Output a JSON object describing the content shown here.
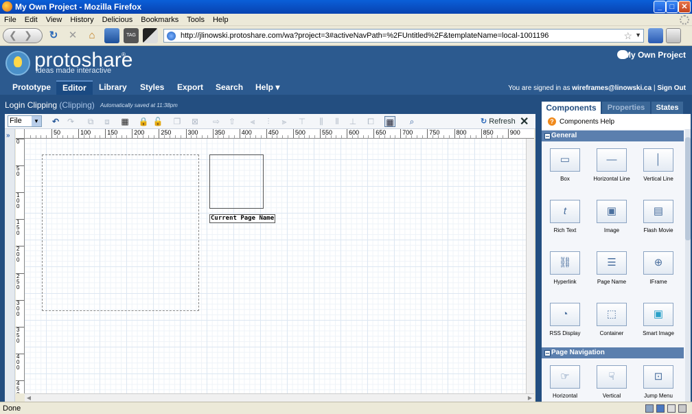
{
  "window": {
    "title": "My Own Project - Mozilla Firefox",
    "min": "_",
    "max": "□",
    "close": "✕"
  },
  "menu": [
    "File",
    "Edit",
    "View",
    "History",
    "Delicious",
    "Bookmarks",
    "Tools",
    "Help"
  ],
  "nav": {
    "url": "http://jlinowski.protoshare.com/wa?project=3#activeNavPath=%2FUntitled%2F&templateName=local-1001196"
  },
  "app": {
    "logo": "protoshare",
    "logo_reg": "®",
    "tagline": "ideas made interactive",
    "project_name": "My Own Project",
    "tabs": [
      "Prototype",
      "Editor",
      "Library",
      "Styles",
      "Export",
      "Search",
      "Help ▾"
    ],
    "signed_in_prefix": "You are signed in as ",
    "user": "wireframes@linowski.ca",
    "separator": " | ",
    "sign_out": "Sign Out"
  },
  "editor": {
    "page_title": "Login Clipping",
    "page_type": "(Clipping)",
    "saved": "Automatically saved at 11:38pm",
    "file_select": "File",
    "refresh": "Refresh",
    "collapse": "»"
  },
  "ruler": {
    "h": [
      "50",
      "100",
      "150",
      "200",
      "250",
      "300",
      "350",
      "400",
      "450",
      "500",
      "550",
      "600",
      "650",
      "700",
      "750",
      "800",
      "850",
      "900"
    ],
    "v": [
      "0",
      "5\n0",
      "1\n0\n0",
      "1\n5\n0",
      "2\n0\n0",
      "2\n5\n0",
      "3\n0\n0",
      "3\n5\n0",
      "4\n0\n0",
      "4\n5\n0"
    ]
  },
  "canvas": {
    "page_name_widget": "Current Page Name"
  },
  "panel": {
    "tabs": [
      "Components",
      "Properties",
      "States"
    ],
    "help": "Components Help",
    "sections": [
      {
        "title": "General",
        "items": [
          {
            "label": "Box",
            "icon": "box-icon"
          },
          {
            "label": "Horizontal Line",
            "icon": "horizontal-line-icon"
          },
          {
            "label": "Vertical Line",
            "icon": "vertical-line-icon"
          },
          {
            "label": "Rich Text",
            "icon": "rich-text-icon"
          },
          {
            "label": "Image",
            "icon": "image-icon"
          },
          {
            "label": "Flash Movie",
            "icon": "flash-movie-icon"
          },
          {
            "label": "Hyperlink",
            "icon": "hyperlink-icon"
          },
          {
            "label": "Page Name",
            "icon": "page-name-icon"
          },
          {
            "label": "IFrame",
            "icon": "iframe-icon"
          },
          {
            "label": "RSS Display",
            "icon": "rss-icon"
          },
          {
            "label": "Container",
            "icon": "container-icon"
          },
          {
            "label": "Smart Image",
            "icon": "smart-image-icon"
          }
        ]
      },
      {
        "title": "Page Navigation",
        "items": [
          {
            "label": "Horizontal",
            "icon": "horizontal-nav-icon"
          },
          {
            "label": "Vertical",
            "icon": "vertical-nav-icon"
          },
          {
            "label": "Jump Menu",
            "icon": "jump-menu-icon"
          }
        ]
      }
    ]
  },
  "status": {
    "text": "Done"
  },
  "colors": {
    "app_bg": "#2c5a8f",
    "app_dark": "#234e80",
    "accent_orange": "#f08a1c"
  }
}
